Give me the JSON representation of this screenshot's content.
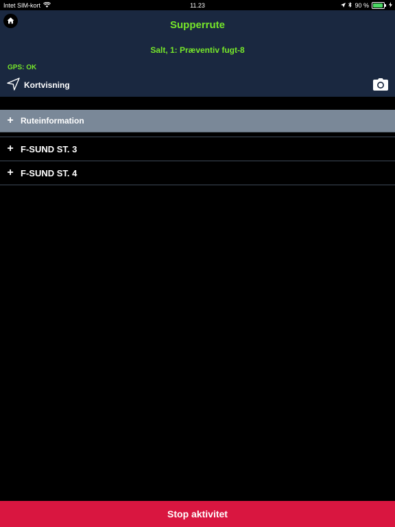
{
  "status_bar": {
    "carrier": "Intet SIM-kort",
    "time": "11.23",
    "battery_percent": "90 %",
    "battery_level": 0.9
  },
  "header": {
    "title": "Supperrute",
    "subtitle": "Salt, 1: Præventiv fugt-8",
    "gps_status": "GPS: OK",
    "map_view_label": "Kortvisning"
  },
  "sections": {
    "route_info": "Ruteinformation",
    "items": [
      {
        "label": "F-SUND ST. 3"
      },
      {
        "label": "F-SUND ST. 4"
      }
    ]
  },
  "footer": {
    "stop_label": "Stop aktivitet"
  },
  "colors": {
    "header_bg": "#1a2840",
    "accent_green": "#76e62a",
    "stop_red": "#d91640",
    "section_bg": "#7a8898"
  },
  "icons": {
    "home": "home-icon",
    "navigation": "navigation-arrow-icon",
    "camera": "camera-icon",
    "plus": "plus-icon",
    "wifi": "wifi-icon",
    "location": "location-arrow-icon",
    "bluetooth": "bluetooth-icon",
    "battery": "battery-icon",
    "charging": "charging-bolt-icon"
  }
}
